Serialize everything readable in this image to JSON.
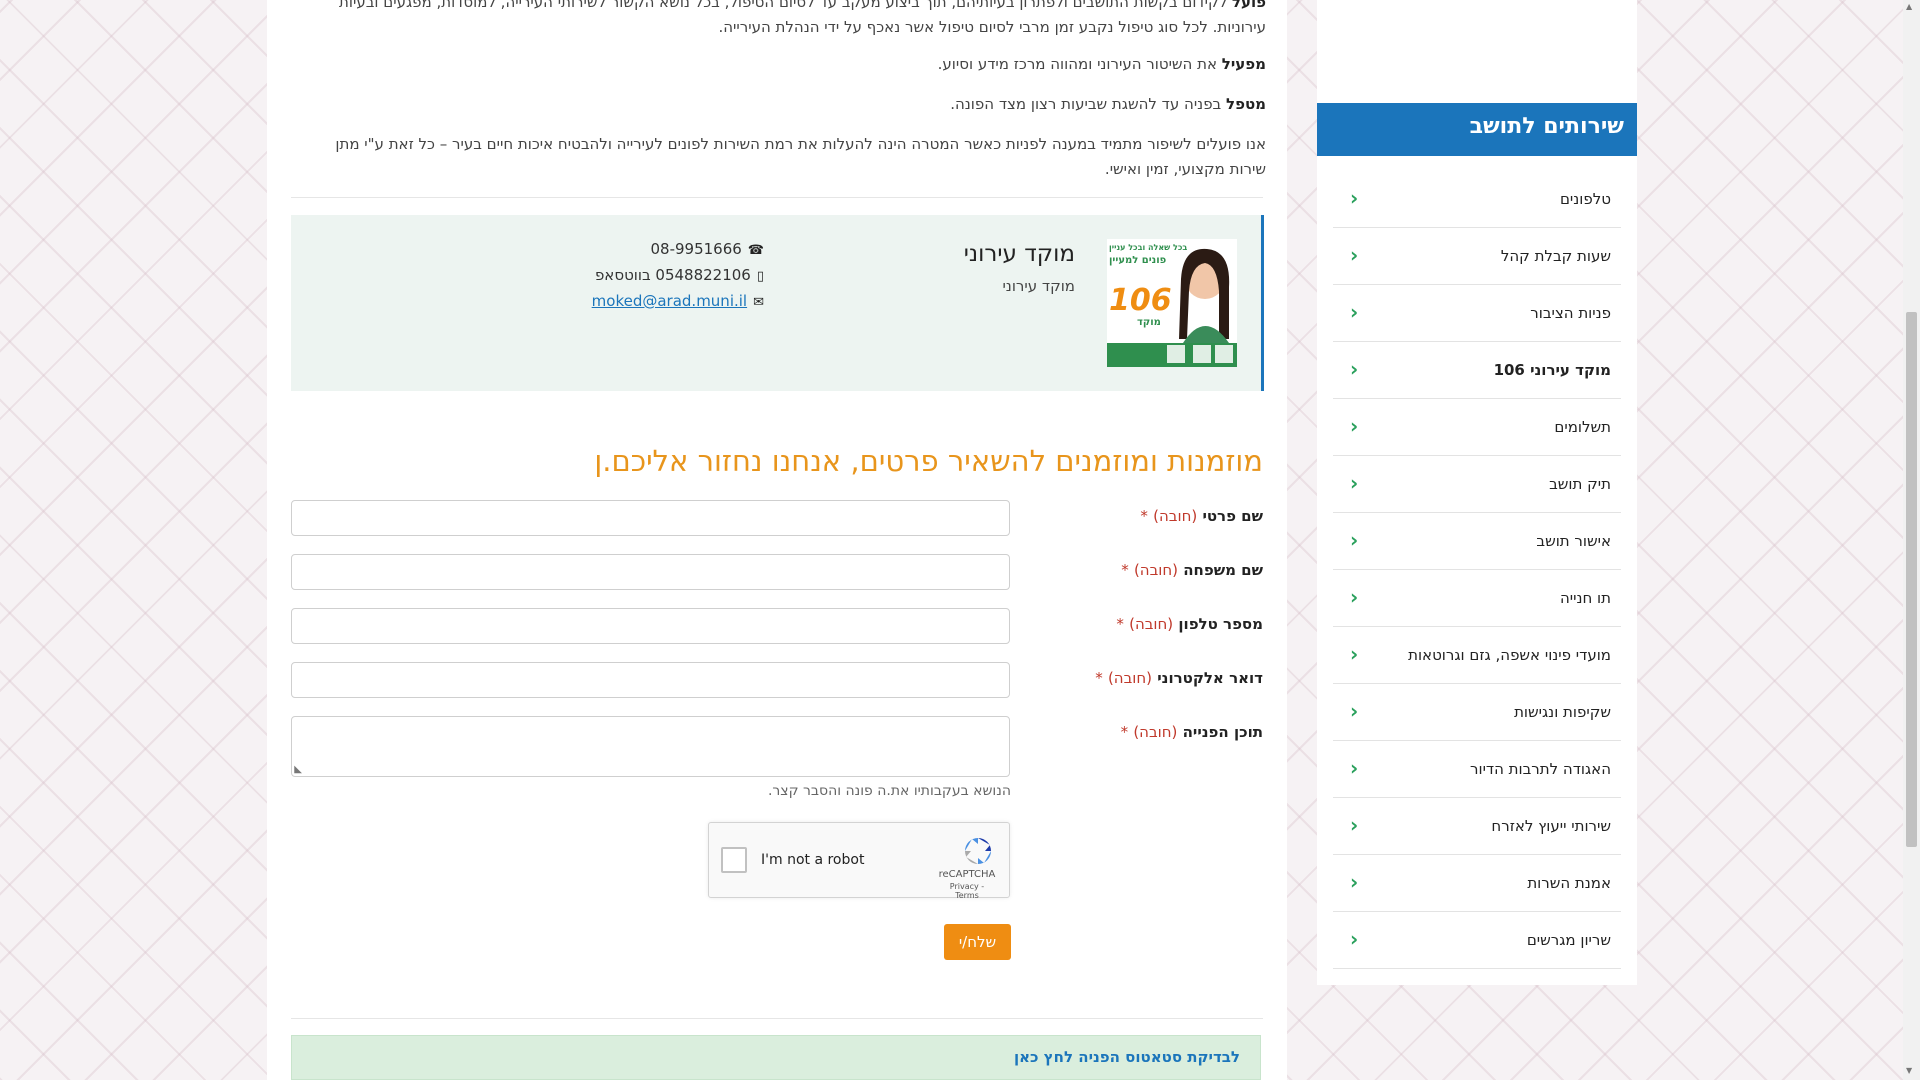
{
  "intro": {
    "p1_bold": "פועל",
    "p1_text": "לקידום בקשות התושבים ולפתרון בעיותיהם, תוך ביצוע מעקב עד לסיום הטיפול, בכל נושא הקשור לשירותי העירייה, למוסדות, מפגעים ובעיות עירוניות. לכל סוג טיפול נקבע זמן מרבי לסיום טיפול אשר נאכף על ידי הנהלת העירייה.",
    "p2_bold": "מפעיל",
    "p2_text": "את השיטור העירוני ומהווה מרכז מידע וסיוע.",
    "p3_bold": "מטפל",
    "p3_text": "בפניה עד להשגת שביעות רצון מצד הפונה.",
    "p4_text": "אנו פועלים לשיפור מתמיד במענה לפניות כאשר המטרה הינה להעלות את רמת השירות לפונים לעירייה ולהבטיח איכות חיים בעיר – כל זאת ע\"י מתן שירות מקצועי, זמין ואישי."
  },
  "card": {
    "title": "מוקד עירוני",
    "subtitle": "מוקד עירוני",
    "phone": "08-9951666",
    "whatsapp": "0548822106 בווטסאפ",
    "email": "moked@arad.muni.il",
    "poster": {
      "line1": "בכל שאלה ובכל עניין",
      "line2": "פונים למעיין",
      "number": "106",
      "word": "מוקד"
    }
  },
  "form": {
    "heading": "מוזמנות ומוזמנים להשאיר פרטים, אנחנו נחזור אליכם.ן",
    "required_text": "(חובה)",
    "star": "*",
    "fields": [
      {
        "label": "שם פרטי"
      },
      {
        "label": "שם משפחה"
      },
      {
        "label": "מספר טלפון"
      },
      {
        "label": "דואר אלקטרוני"
      },
      {
        "label": "תוכן הפנייה"
      }
    ],
    "help": "הנושא בעקבותיו את.ה פונה והסבר קצר.",
    "captcha": {
      "text": "I'm not a robot",
      "brand": "reCAPTCHA",
      "terms": "Privacy - Terms"
    },
    "submit": "שלח/י"
  },
  "status_link": "לבדיקת סטאטוס הפניה לחץ כאן",
  "sidebar": {
    "title": "שירותים לתושב",
    "items": [
      {
        "label": "טלפונים"
      },
      {
        "label": "שעות קבלת קהל"
      },
      {
        "label": "פניות הציבור"
      },
      {
        "label": "מוקד עירוני 106"
      },
      {
        "label": "תשלומים"
      },
      {
        "label": "תיק תושב"
      },
      {
        "label": "אישור תושב"
      },
      {
        "label": "תו חנייה"
      },
      {
        "label": "מועדי פינוי אשפה, גזם וגרוטאות"
      },
      {
        "label": "שקיפות ונגישות"
      },
      {
        "label": "האגודה לתרבות הדיור"
      },
      {
        "label": "שירותי ייעוץ לאזרח"
      },
      {
        "label": "אמנת השרות"
      },
      {
        "label": "שריון מגרשים"
      }
    ]
  },
  "colors": {
    "accent": "#1b75bb",
    "orange": "#ef8d12",
    "heading": "#e8951c",
    "chevron": "#2aa05c"
  }
}
